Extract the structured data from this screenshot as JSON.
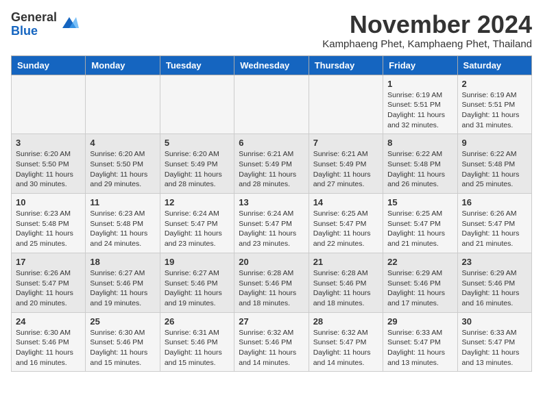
{
  "header": {
    "logo_general": "General",
    "logo_blue": "Blue",
    "month_title": "November 2024",
    "location": "Kamphaeng Phet, Kamphaeng Phet, Thailand"
  },
  "weekdays": [
    "Sunday",
    "Monday",
    "Tuesday",
    "Wednesday",
    "Thursday",
    "Friday",
    "Saturday"
  ],
  "weeks": [
    [
      {
        "day": "",
        "info": ""
      },
      {
        "day": "",
        "info": ""
      },
      {
        "day": "",
        "info": ""
      },
      {
        "day": "",
        "info": ""
      },
      {
        "day": "",
        "info": ""
      },
      {
        "day": "1",
        "info": "Sunrise: 6:19 AM\nSunset: 5:51 PM\nDaylight: 11 hours and 32 minutes."
      },
      {
        "day": "2",
        "info": "Sunrise: 6:19 AM\nSunset: 5:51 PM\nDaylight: 11 hours and 31 minutes."
      }
    ],
    [
      {
        "day": "3",
        "info": "Sunrise: 6:20 AM\nSunset: 5:50 PM\nDaylight: 11 hours and 30 minutes."
      },
      {
        "day": "4",
        "info": "Sunrise: 6:20 AM\nSunset: 5:50 PM\nDaylight: 11 hours and 29 minutes."
      },
      {
        "day": "5",
        "info": "Sunrise: 6:20 AM\nSunset: 5:49 PM\nDaylight: 11 hours and 28 minutes."
      },
      {
        "day": "6",
        "info": "Sunrise: 6:21 AM\nSunset: 5:49 PM\nDaylight: 11 hours and 28 minutes."
      },
      {
        "day": "7",
        "info": "Sunrise: 6:21 AM\nSunset: 5:49 PM\nDaylight: 11 hours and 27 minutes."
      },
      {
        "day": "8",
        "info": "Sunrise: 6:22 AM\nSunset: 5:48 PM\nDaylight: 11 hours and 26 minutes."
      },
      {
        "day": "9",
        "info": "Sunrise: 6:22 AM\nSunset: 5:48 PM\nDaylight: 11 hours and 25 minutes."
      }
    ],
    [
      {
        "day": "10",
        "info": "Sunrise: 6:23 AM\nSunset: 5:48 PM\nDaylight: 11 hours and 25 minutes."
      },
      {
        "day": "11",
        "info": "Sunrise: 6:23 AM\nSunset: 5:48 PM\nDaylight: 11 hours and 24 minutes."
      },
      {
        "day": "12",
        "info": "Sunrise: 6:24 AM\nSunset: 5:47 PM\nDaylight: 11 hours and 23 minutes."
      },
      {
        "day": "13",
        "info": "Sunrise: 6:24 AM\nSunset: 5:47 PM\nDaylight: 11 hours and 23 minutes."
      },
      {
        "day": "14",
        "info": "Sunrise: 6:25 AM\nSunset: 5:47 PM\nDaylight: 11 hours and 22 minutes."
      },
      {
        "day": "15",
        "info": "Sunrise: 6:25 AM\nSunset: 5:47 PM\nDaylight: 11 hours and 21 minutes."
      },
      {
        "day": "16",
        "info": "Sunrise: 6:26 AM\nSunset: 5:47 PM\nDaylight: 11 hours and 21 minutes."
      }
    ],
    [
      {
        "day": "17",
        "info": "Sunrise: 6:26 AM\nSunset: 5:47 PM\nDaylight: 11 hours and 20 minutes."
      },
      {
        "day": "18",
        "info": "Sunrise: 6:27 AM\nSunset: 5:46 PM\nDaylight: 11 hours and 19 minutes."
      },
      {
        "day": "19",
        "info": "Sunrise: 6:27 AM\nSunset: 5:46 PM\nDaylight: 11 hours and 19 minutes."
      },
      {
        "day": "20",
        "info": "Sunrise: 6:28 AM\nSunset: 5:46 PM\nDaylight: 11 hours and 18 minutes."
      },
      {
        "day": "21",
        "info": "Sunrise: 6:28 AM\nSunset: 5:46 PM\nDaylight: 11 hours and 18 minutes."
      },
      {
        "day": "22",
        "info": "Sunrise: 6:29 AM\nSunset: 5:46 PM\nDaylight: 11 hours and 17 minutes."
      },
      {
        "day": "23",
        "info": "Sunrise: 6:29 AM\nSunset: 5:46 PM\nDaylight: 11 hours and 16 minutes."
      }
    ],
    [
      {
        "day": "24",
        "info": "Sunrise: 6:30 AM\nSunset: 5:46 PM\nDaylight: 11 hours and 16 minutes."
      },
      {
        "day": "25",
        "info": "Sunrise: 6:30 AM\nSunset: 5:46 PM\nDaylight: 11 hours and 15 minutes."
      },
      {
        "day": "26",
        "info": "Sunrise: 6:31 AM\nSunset: 5:46 PM\nDaylight: 11 hours and 15 minutes."
      },
      {
        "day": "27",
        "info": "Sunrise: 6:32 AM\nSunset: 5:46 PM\nDaylight: 11 hours and 14 minutes."
      },
      {
        "day": "28",
        "info": "Sunrise: 6:32 AM\nSunset: 5:47 PM\nDaylight: 11 hours and 14 minutes."
      },
      {
        "day": "29",
        "info": "Sunrise: 6:33 AM\nSunset: 5:47 PM\nDaylight: 11 hours and 13 minutes."
      },
      {
        "day": "30",
        "info": "Sunrise: 6:33 AM\nSunset: 5:47 PM\nDaylight: 11 hours and 13 minutes."
      }
    ]
  ]
}
